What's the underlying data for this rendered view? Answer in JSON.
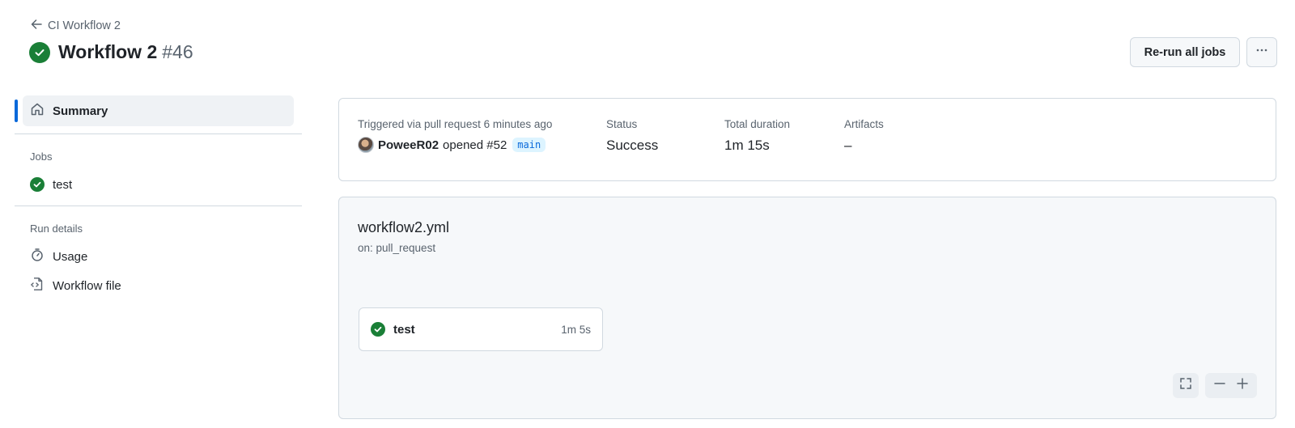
{
  "header": {
    "back_label": "CI Workflow 2",
    "title": "Workflow 2",
    "run_number": "#46",
    "rerun_label": "Re-run all jobs"
  },
  "sidebar": {
    "summary_label": "Summary",
    "jobs_heading": "Jobs",
    "jobs": [
      {
        "label": "test",
        "status": "success"
      }
    ],
    "run_details_heading": "Run details",
    "usage_label": "Usage",
    "workflow_file_label": "Workflow file"
  },
  "summary": {
    "trigger_label": "Triggered via pull request 6 minutes ago",
    "user": "PoweeR02",
    "action": "opened #52",
    "branch": "main",
    "status_label": "Status",
    "status_value": "Success",
    "duration_label": "Total duration",
    "duration_value": "1m 15s",
    "artifacts_label": "Artifacts",
    "artifacts_value": "–"
  },
  "graph": {
    "file_name": "workflow2.yml",
    "trigger": "on: pull_request",
    "job": {
      "name": "test",
      "duration": "1m 5s",
      "status": "success"
    }
  },
  "colors": {
    "success": "#1a7f37",
    "accent": "#0969da",
    "border": "#d1d9e0",
    "muted_text": "#59636e"
  },
  "icons": [
    "arrow-left-icon",
    "check-circle-icon",
    "kebab-horizontal-icon",
    "home-icon",
    "stopwatch-icon",
    "file-code-icon",
    "fullscreen-icon",
    "zoom-out-icon",
    "zoom-in-icon"
  ]
}
